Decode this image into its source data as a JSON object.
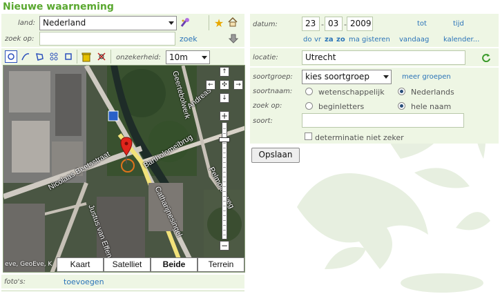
{
  "page": {
    "title": "Nieuwe waarneming"
  },
  "left": {
    "land_label": "land:",
    "land_value": "Nederland",
    "zoek_op_label": "zoek op:",
    "zoek_op_value": "",
    "zoek_link": "zoek",
    "onzekerheid_label": "onzekerheid:",
    "onzekerheid_value": "10m",
    "fotos_label": "foto's:",
    "toevoegen_link": "toevoegen"
  },
  "map": {
    "buttons": [
      "Kaart",
      "Satelliet",
      "Beide",
      "Terrein"
    ],
    "selected": "Beide",
    "nav": {
      "up": "↑",
      "left": "←",
      "center": "✣",
      "right": "→",
      "down": "↓",
      "zoom_in": "+",
      "zoom_out": "−"
    },
    "streets": [
      "Nicolaas Beetsstraat",
      "Bartholomeïbrug",
      "Catharijnesingel",
      "Justus van Effenstr",
      "Pelmolenweg",
      "Andreas",
      "Geertebolwerk"
    ],
    "credit": "eve, GeoEve, K"
  },
  "right": {
    "datum_label": "datum:",
    "day": "23",
    "month": "03",
    "year": "2009",
    "tot_link": "tot",
    "tijd_link": "tijd",
    "date_links": {
      "do": "do",
      "vr": "vr",
      "za": "za",
      "zo": "zo",
      "ma": "ma",
      "gisteren": "gisteren",
      "vandaag": "vandaag"
    },
    "kalender_link": "kalender...",
    "locatie_label": "locatie:",
    "locatie_value": "Utrecht",
    "soortgroep_label": "soortgroep:",
    "soortgroep_value": "kies soortgroep",
    "meer_groepen_link": "meer groepen",
    "soortnaam_label": "soortnaam:",
    "soortnaam_opt1": "wetenschappelijk",
    "soortnaam_opt2": "Nederlands",
    "soortnaam_selected": "Nederlands",
    "zoek_op_label": "zoek op:",
    "zoek_opt1": "beginletters",
    "zoek_opt2": "hele naam",
    "zoek_selected": "hele naam",
    "soort_label": "soort:",
    "soort_value": "",
    "determinatie_label": "determinatie niet zeker",
    "determinatie_checked": false,
    "opslaan_button": "Opslaan"
  },
  "colors": {
    "title": "#5aa830",
    "link": "#2a73b8",
    "panel": "#eef6e4"
  }
}
